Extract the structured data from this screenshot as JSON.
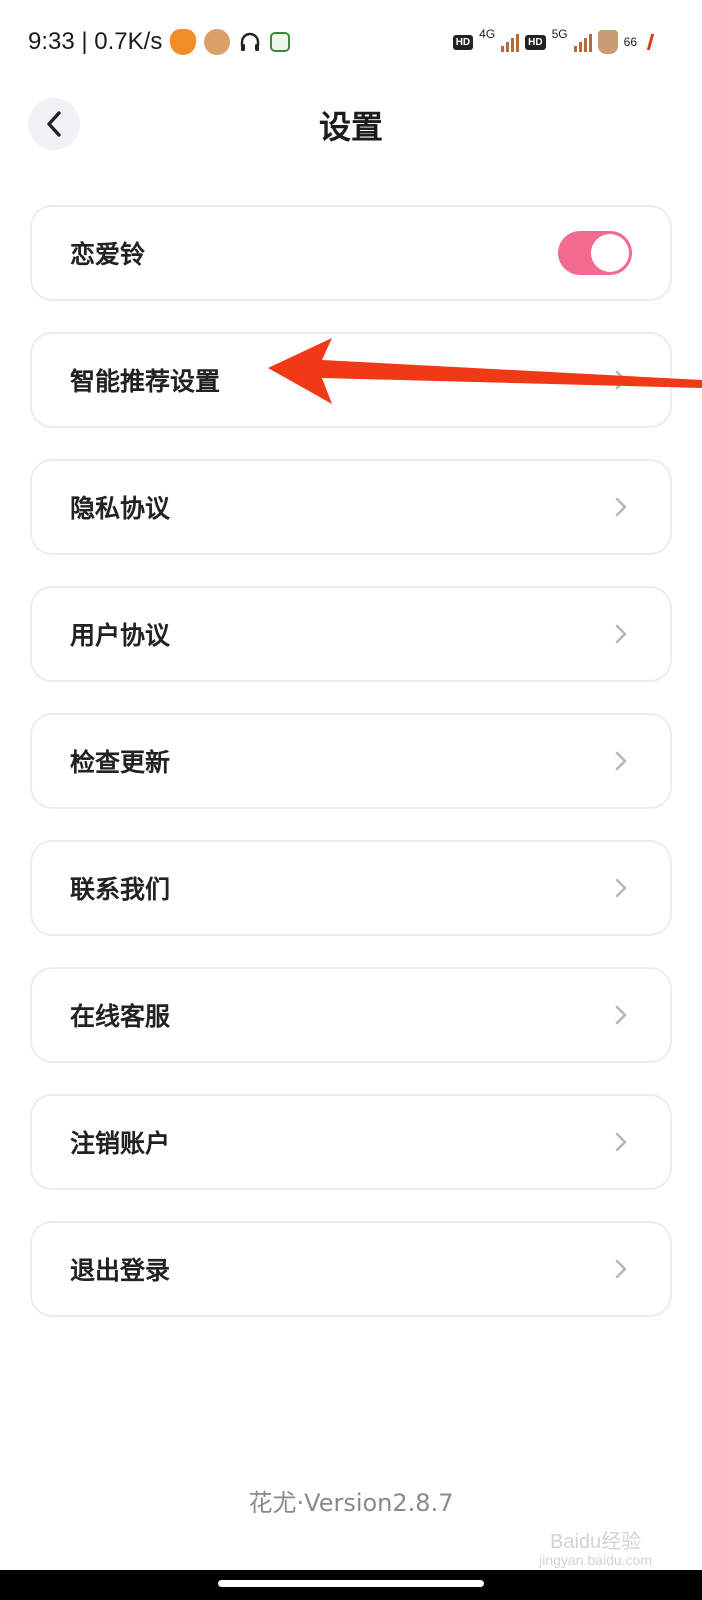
{
  "status_bar": {
    "time_speed": "9:33 | 0.7K/s",
    "sim1_net": "4G",
    "sim2_net": "5G",
    "battery": "66"
  },
  "header": {
    "title": "设置"
  },
  "settings": {
    "items": [
      {
        "label": "恋爱铃",
        "type": "toggle",
        "on": true
      },
      {
        "label": "智能推荐设置",
        "type": "link"
      },
      {
        "label": "隐私协议",
        "type": "link"
      },
      {
        "label": "用户协议",
        "type": "link"
      },
      {
        "label": "检查更新",
        "type": "link"
      },
      {
        "label": "联系我们",
        "type": "link"
      },
      {
        "label": "在线客服",
        "type": "link"
      },
      {
        "label": "注销账户",
        "type": "link"
      },
      {
        "label": "退出登录",
        "type": "link"
      }
    ]
  },
  "footer": {
    "version": "花尤·Version2.8.7"
  },
  "watermark": {
    "text": "Baidu经验",
    "sub": "jingyan.baidu.com"
  },
  "colors": {
    "toggle_on": "#f26a8d",
    "arrow": "#f03a17",
    "border": "#ebedf0"
  }
}
